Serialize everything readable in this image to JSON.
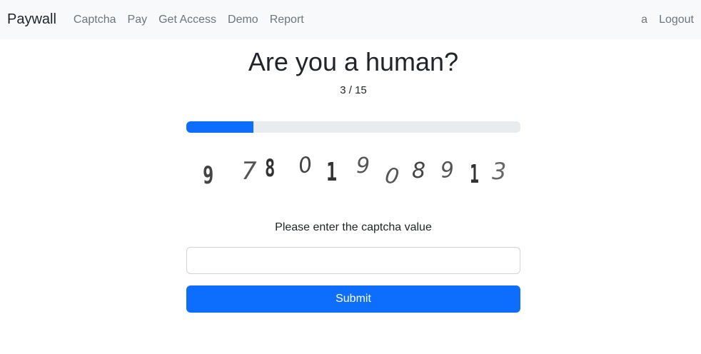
{
  "navbar": {
    "brand": "Paywall",
    "links": [
      "Captcha",
      "Pay",
      "Get Access",
      "Demo",
      "Report"
    ],
    "user": "a",
    "logout": "Logout"
  },
  "main": {
    "title": "Are you a human?",
    "step_current": 3,
    "step_total": 15,
    "counter_text": "3 / 15",
    "progress_fraction": 0.2,
    "captcha": {
      "characters": [
        "9",
        "7",
        "8",
        "0",
        "1",
        "9",
        "0",
        "8",
        "9",
        "1",
        "3"
      ]
    },
    "prompt": "Please enter the captcha value",
    "input_value": "",
    "submit_label": "Submit"
  },
  "colors": {
    "accent": "#0d6efd",
    "navbar_bg": "#f8f9fa",
    "progress_track": "#e9ecef"
  }
}
